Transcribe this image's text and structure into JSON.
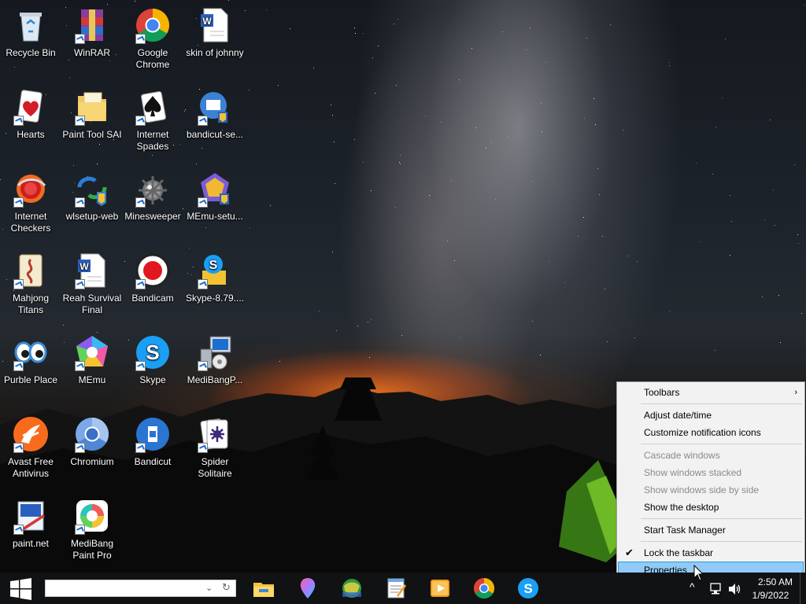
{
  "desktop": {
    "icons": [
      {
        "label": "Recycle Bin",
        "icon": "recycle-bin-icon"
      },
      {
        "label": "WinRAR",
        "icon": "winrar-icon"
      },
      {
        "label": "Google Chrome",
        "icon": "chrome-icon"
      },
      {
        "label": "skin of johnny",
        "icon": "word-document-icon"
      },
      {
        "label": "Hearts",
        "icon": "hearts-icon"
      },
      {
        "label": "Paint Tool SAI",
        "icon": "folder-icon"
      },
      {
        "label": "Internet Spades",
        "icon": "spades-icon"
      },
      {
        "label": "bandicut-se...",
        "icon": "installer-icon"
      },
      {
        "label": "Internet Checkers",
        "icon": "checkers-icon"
      },
      {
        "label": "wlsetup-web",
        "icon": "windows-live-icon"
      },
      {
        "label": "Minesweeper",
        "icon": "minesweeper-icon"
      },
      {
        "label": "MEmu-setu...",
        "icon": "memu-setup-icon"
      },
      {
        "label": "Mahjong Titans",
        "icon": "mahjong-icon"
      },
      {
        "label": "Reah Survival Final",
        "icon": "word-document-icon"
      },
      {
        "label": "Bandicam",
        "icon": "bandicam-icon"
      },
      {
        "label": "Skype-8.79....",
        "icon": "skype-setup-icon"
      },
      {
        "label": "Purble Place",
        "icon": "purble-place-icon"
      },
      {
        "label": "MEmu",
        "icon": "memu-icon"
      },
      {
        "label": "Skype",
        "icon": "skype-icon"
      },
      {
        "label": "MediBangP...",
        "icon": "installer-computer-icon"
      },
      {
        "label": "Avast Free Antivirus",
        "icon": "avast-icon"
      },
      {
        "label": "Chromium",
        "icon": "chromium-icon"
      },
      {
        "label": "Bandicut",
        "icon": "bandicut-icon"
      },
      {
        "label": "Spider Solitaire",
        "icon": "spider-solitaire-icon"
      },
      {
        "label": "paint.net",
        "icon": "paintnet-icon"
      },
      {
        "label": "MediBang Paint Pro",
        "icon": "medibang-icon"
      }
    ]
  },
  "context_menu": {
    "items": [
      {
        "label": "Toolbars",
        "state": "enabled",
        "submenu": true
      },
      {
        "label": "Adjust date/time",
        "state": "enabled"
      },
      {
        "label": "Customize notification icons",
        "state": "enabled"
      },
      {
        "label": "Cascade windows",
        "state": "disabled"
      },
      {
        "label": "Show windows stacked",
        "state": "disabled"
      },
      {
        "label": "Show windows side by side",
        "state": "disabled"
      },
      {
        "label": "Show the desktop",
        "state": "enabled"
      },
      {
        "label": "Start Task Manager",
        "state": "enabled"
      },
      {
        "label": "Lock the taskbar",
        "state": "checked"
      },
      {
        "label": "Properties",
        "state": "highlighted"
      }
    ],
    "submenu_arrow": "›",
    "check_mark": "✔"
  },
  "taskbar": {
    "search": {
      "value": "",
      "placeholder": ""
    },
    "pinned_apps": [
      {
        "name": "File Explorer",
        "icon": "file-explorer-icon"
      },
      {
        "name": "Maps",
        "icon": "maps-pin-icon"
      },
      {
        "name": "Game",
        "icon": "game-globe-icon"
      },
      {
        "name": "Notepad",
        "icon": "notepad-icon"
      },
      {
        "name": "Video Player",
        "icon": "video-player-icon"
      },
      {
        "name": "Google Chrome",
        "icon": "chrome-icon"
      },
      {
        "name": "Skype",
        "icon": "skype-icon"
      }
    ],
    "tray": {
      "chevron": "^",
      "clock_time": "2:50 AM",
      "clock_date": "1/9/2022"
    }
  },
  "colors": {
    "taskbar_bg": "#101214",
    "menu_bg": "#f2f2f2",
    "menu_highlight": "#91c9f7",
    "disabled_text": "#8a8a8a",
    "windows_blue": "#1a9ff5"
  }
}
